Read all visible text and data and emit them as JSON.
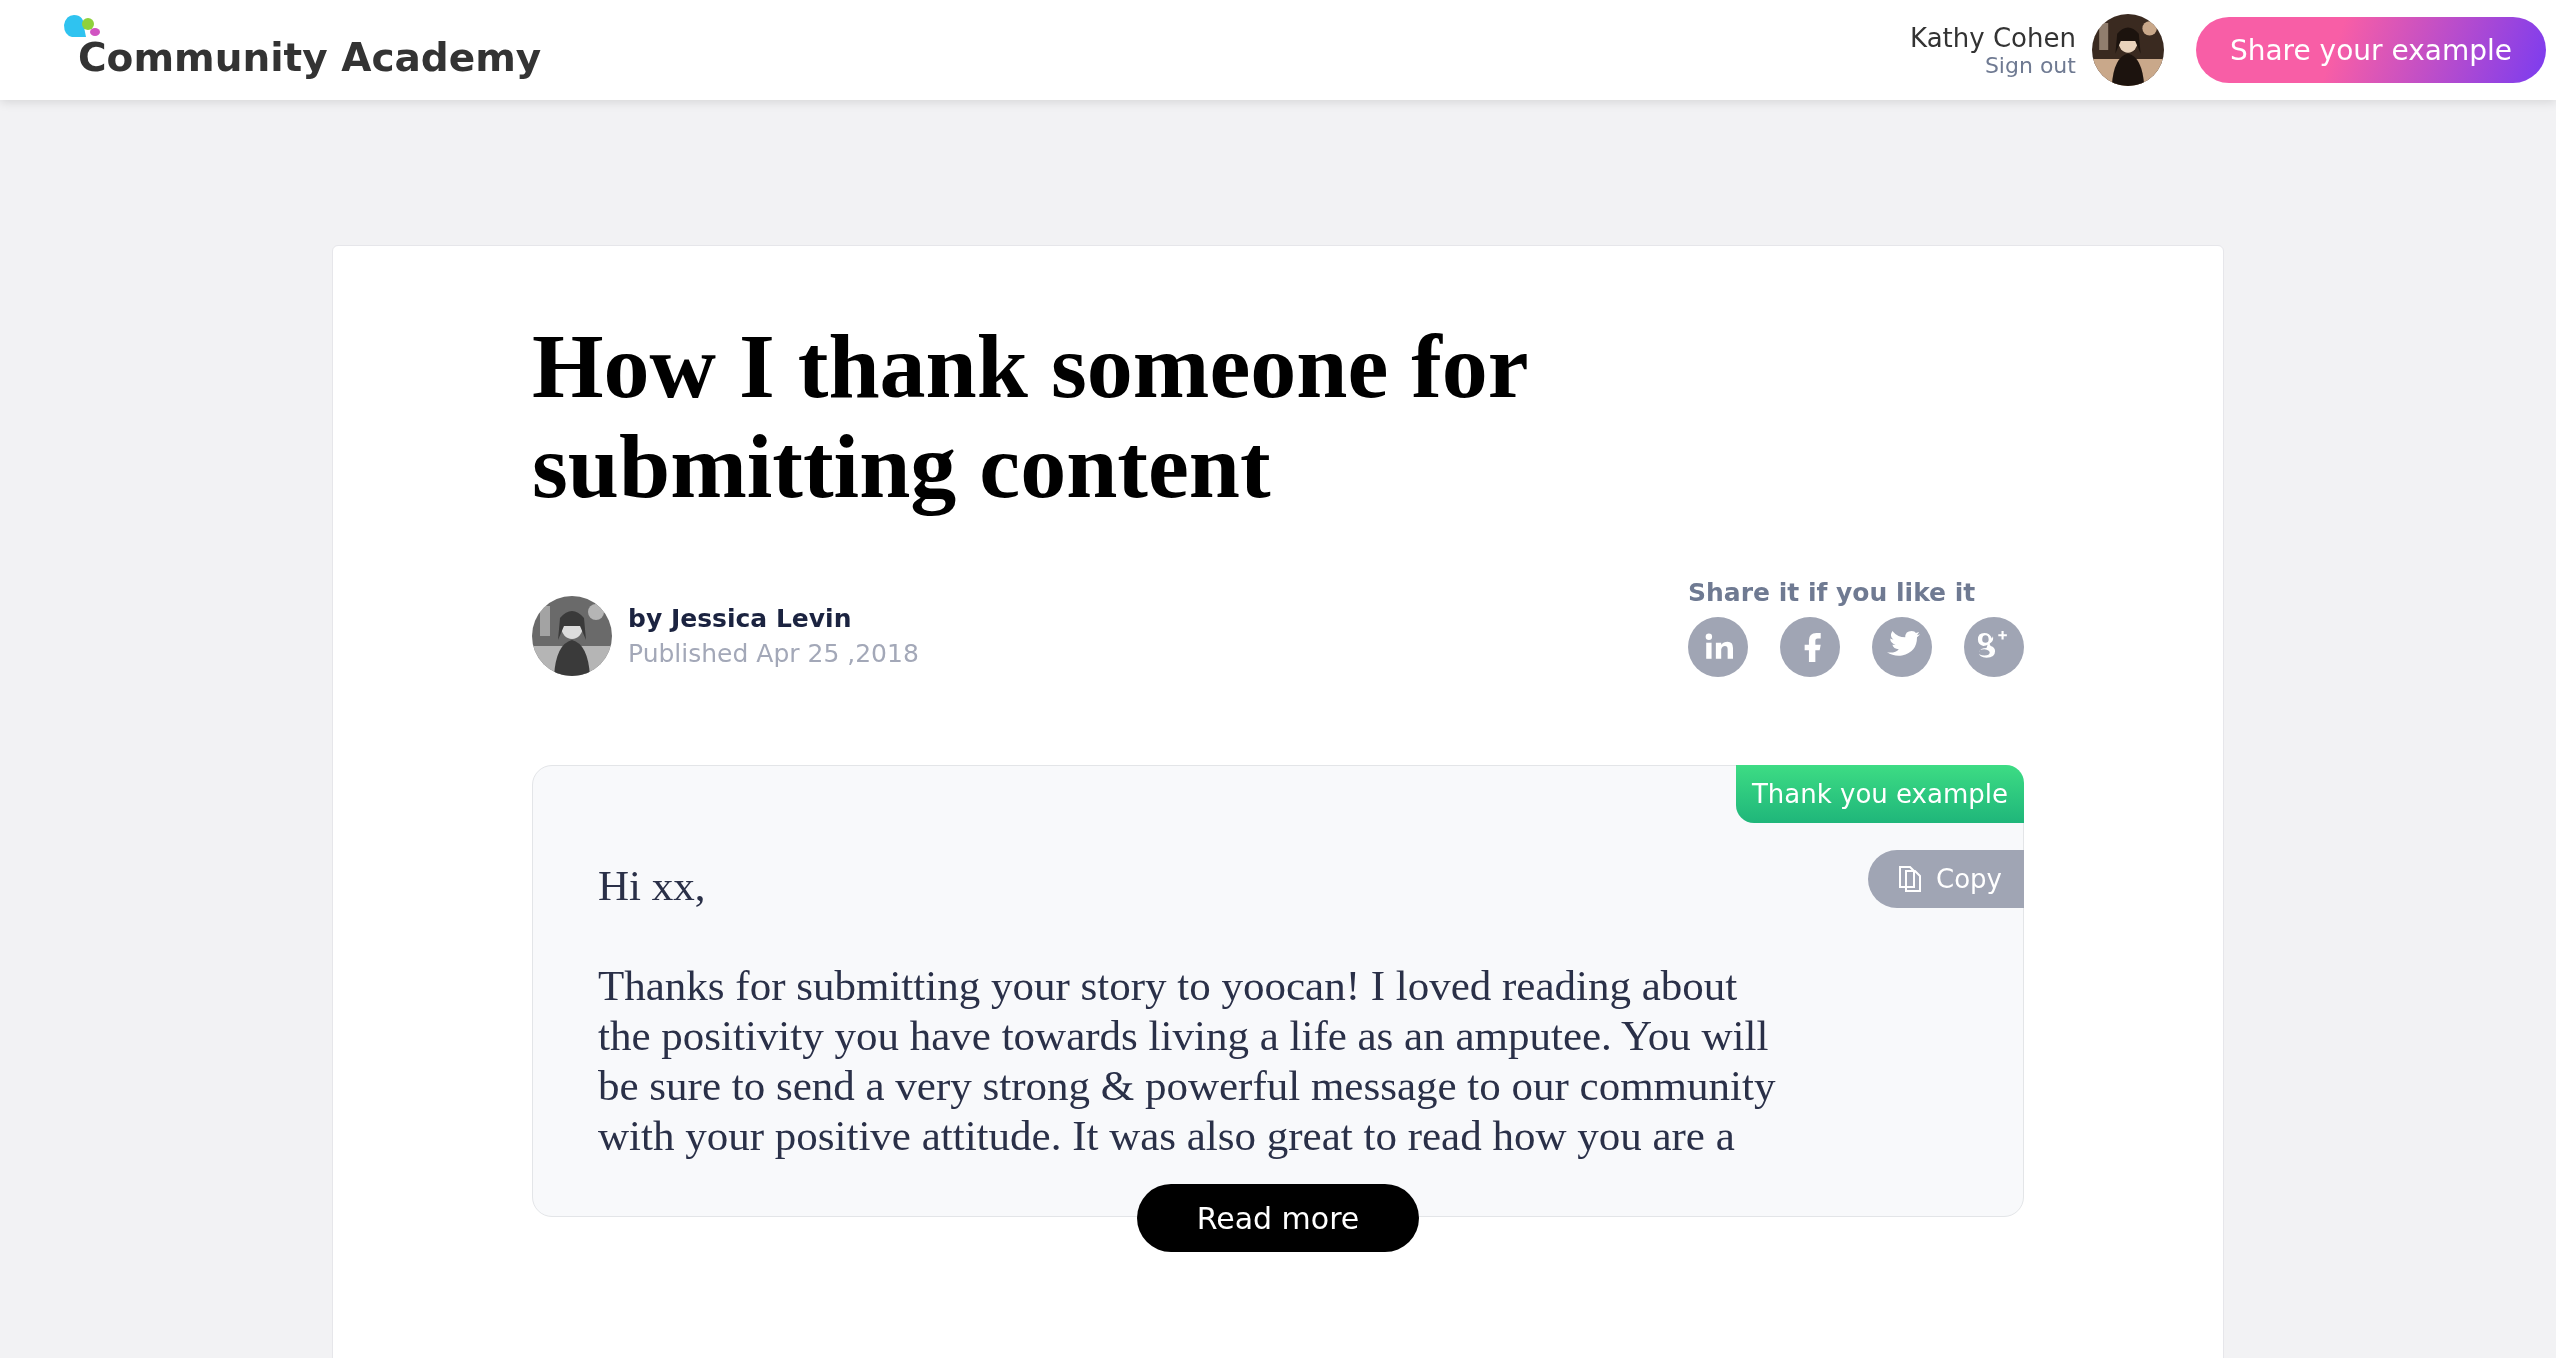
{
  "header": {
    "logo": "Community Academy",
    "user": {
      "name": "Kathy Cohen",
      "sign_out": "Sign out"
    },
    "share_button": "Share your example"
  },
  "article": {
    "title": "How I thank someone for submitting content",
    "author": {
      "byline": "by Jessica Levin",
      "published": "Published Apr 25 ,2018"
    },
    "share": {
      "label": "Share it if you like it",
      "networks": [
        {
          "kind": "linkedin"
        },
        {
          "kind": "facebook"
        },
        {
          "kind": "twitter"
        },
        {
          "kind": "googleplus"
        }
      ]
    },
    "example": {
      "tag": "Thank you example",
      "copy_button": "Copy",
      "greeting": "Hi xx,",
      "body_lines": [
        "Thanks for submitting your story to yoocan! I loved reading about",
        "the positivity you have towards living a life as an amputee. You will",
        "be sure to send a very strong & powerful message to our community",
        "with your positive attitude. It was also great to read how you are a"
      ],
      "read_more": "Read more"
    }
  }
}
